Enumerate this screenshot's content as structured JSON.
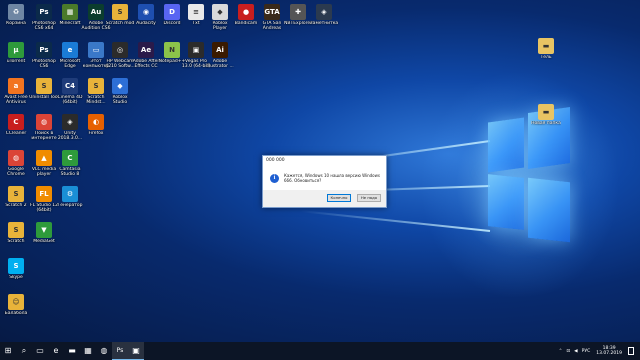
{
  "desktop_icons": [
    {
      "label": "Корзина",
      "icon": "recycle-bin-icon",
      "color": "#6f86a3",
      "glyph": "♻"
    },
    {
      "label": "Photoshop CS6 x64",
      "icon": "photoshop-icon",
      "color": "#0b2a4a",
      "glyph": "Ps"
    },
    {
      "label": "Minecraft",
      "icon": "minecraft-icon",
      "color": "#4a7a2a",
      "glyph": "▦"
    },
    {
      "label": "Adobe Audition CS6",
      "icon": "audition-icon",
      "color": "#0b3d2e",
      "glyph": "Au"
    },
    {
      "label": "Scratch mod",
      "icon": "scratch-mod-icon",
      "color": "#e8b33a",
      "glyph": "S"
    },
    {
      "label": "Audacity",
      "icon": "audacity-icon",
      "color": "#1e4fb0",
      "glyph": "◉"
    },
    {
      "label": "Discord",
      "icon": "discord-icon",
      "color": "#5865f2",
      "glyph": "D"
    },
    {
      "label": "Txt",
      "icon": "text-file-icon",
      "color": "#e9e9e9",
      "glyph": "≡"
    },
    {
      "label": "Roblox Player",
      "icon": "roblox-icon",
      "color": "#d9d9d9",
      "glyph": "◆"
    },
    {
      "label": "Bandicam",
      "icon": "bandicam-icon",
      "color": "#c81e1e",
      "glyph": "●"
    },
    {
      "label": "GTA San Andreas",
      "icon": "gta-icon",
      "color": "#3a2a1a",
      "glyph": "GTA"
    },
    {
      "label": "NBTExplorer",
      "icon": "nbtexplorer-icon",
      "color": "#555",
      "glyph": "✚"
    },
    {
      "label": "Заметнитка",
      "icon": "unity-icon",
      "color": "#2b3a4f",
      "glyph": "◈"
    },
    {
      "label": "uTorrent",
      "icon": "utorrent-icon",
      "color": "#2e9a3b",
      "glyph": "µ"
    },
    {
      "label": "Photoshop CS6",
      "icon": "photoshop-icon",
      "color": "#0b2a4a",
      "glyph": "Ps"
    },
    {
      "label": "Microsoft Edge",
      "icon": "edge-icon",
      "color": "#1a7bd6",
      "glyph": "e"
    },
    {
      "label": "Этот компьютер",
      "icon": "computer-icon",
      "color": "#3a78c8",
      "glyph": "▭"
    },
    {
      "label": "HP Webcam 4210 Softw...",
      "icon": "webcam-icon",
      "color": "#2b2b2b",
      "glyph": "◎"
    },
    {
      "label": "Adobe After Effects CC",
      "icon": "after-effects-icon",
      "color": "#2a1a4a",
      "glyph": "Ae"
    },
    {
      "label": "Notepad++",
      "icon": "notepad-icon",
      "color": "#8bc34a",
      "glyph": "N"
    },
    {
      "label": "Vegas Pro 13.0 (64-bit)",
      "icon": "vegas-icon",
      "color": "#2b2b2b",
      "glyph": "▣"
    },
    {
      "label": "Adobe Illustrator ...",
      "icon": "illustrator-icon",
      "color": "#3a1a00",
      "glyph": "Ai"
    },
    {
      "label": "Avast Free Antivirus",
      "icon": "avast-icon",
      "color": "#f27420",
      "glyph": "a"
    },
    {
      "label": "Uninstall Tool",
      "icon": "uninstall-icon",
      "color": "#e8b33a",
      "glyph": "S"
    },
    {
      "label": "Cinema 4D (64bit)",
      "icon": "cinema4d-icon",
      "color": "#1f3c7a",
      "glyph": "C4"
    },
    {
      "label": "Scratch Mindst...",
      "icon": "scratch-icon",
      "color": "#e8b33a",
      "glyph": "S"
    },
    {
      "label": "Roblox Studio",
      "icon": "roblox-studio-icon",
      "color": "#2d6fd6",
      "glyph": "◆"
    },
    {
      "label": "CCleaner",
      "icon": "ccleaner-icon",
      "color": "#c81e1e",
      "glyph": "C"
    },
    {
      "label": "Поиск в интернете",
      "icon": "chrome-search-icon",
      "color": "#db4437",
      "glyph": "◍"
    },
    {
      "label": "Unity 2018.3.0...",
      "icon": "unity-icon",
      "color": "#2b2b2b",
      "glyph": "◈"
    },
    {
      "label": "Firefox",
      "icon": "firefox-icon",
      "color": "#e66000",
      "glyph": "◐"
    },
    {
      "label": "Google Chrome",
      "icon": "chrome-icon",
      "color": "#db4437",
      "glyph": "◍"
    },
    {
      "label": "VLC media player",
      "icon": "vlc-icon",
      "color": "#f08c00",
      "glyph": "▲"
    },
    {
      "label": "Camtasia Studio 8",
      "icon": "camtasia-icon",
      "color": "#2e9a3b",
      "glyph": "C"
    },
    {
      "label": "Scratch 2",
      "icon": "scratch-icon",
      "color": "#e8b33a",
      "glyph": "S"
    },
    {
      "label": "FL Studio 12 (64bit)",
      "icon": "flstudio-icon",
      "color": "#f08c00",
      "glyph": "FL"
    },
    {
      "label": "Генератор",
      "icon": "generator-icon",
      "color": "#1a8fd6",
      "glyph": "⚙"
    },
    {
      "label": "Scratch",
      "icon": "scratch-icon",
      "color": "#e8b33a",
      "glyph": "S"
    },
    {
      "label": "MediaGet",
      "icon": "mediaget-icon",
      "color": "#2e9a3b",
      "glyph": "▼"
    },
    {
      "label": "Skype",
      "icon": "skype-icon",
      "color": "#00aff0",
      "glyph": "S"
    },
    {
      "label": "Балабола",
      "icon": "balabolka-icon",
      "color": "#e8b33a",
      "glyph": "☺"
    },
    {
      "label": "Тель",
      "icon": "folder-icon",
      "color": "#e8c463",
      "glyph": "▬"
    },
    {
      "label": "Новая папка",
      "icon": "folder-icon",
      "color": "#e8c463",
      "glyph": "▬"
    }
  ],
  "dialog": {
    "title": "000 000",
    "message": "Кажется, Windows 10 нашла версию Windows 666. Обновиться?",
    "primary_button": "Конечно",
    "secondary_button": "Не надо"
  },
  "taskbar": {
    "start_glyph": "⊞",
    "items": [
      {
        "name": "search-icon",
        "glyph": "⌕"
      },
      {
        "name": "task-view-icon",
        "glyph": "▭"
      },
      {
        "name": "edge-taskbar-icon",
        "glyph": "e"
      },
      {
        "name": "file-explorer-icon",
        "glyph": "▬"
      },
      {
        "name": "store-icon",
        "glyph": "▦"
      },
      {
        "name": "chrome-taskbar-icon",
        "glyph": "◍"
      },
      {
        "name": "photoshop-taskbar-icon",
        "glyph": "Ps"
      },
      {
        "name": "app-taskbar-icon",
        "glyph": "▣"
      }
    ],
    "tray": {
      "up_arrow": "⌃",
      "network": "⊡",
      "volume": "◀",
      "language": "РУС",
      "time": "18:39",
      "date": "13.07.2019"
    }
  }
}
